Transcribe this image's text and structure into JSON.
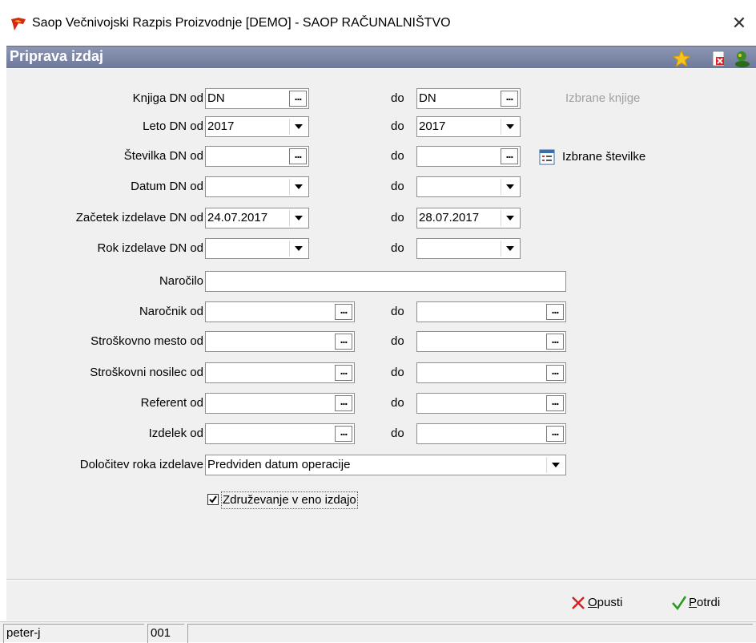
{
  "window": {
    "title": "Saop  Večnivojski Razpis Proizvodnje  [DEMO] - SAOP RAČUNALNIŠTVO",
    "close_glyph": "✕"
  },
  "header": {
    "title": "Priprava izdaj",
    "icons": [
      "star-icon",
      "close-doc-icon",
      "user-icon"
    ]
  },
  "form": {
    "do_label": "do",
    "rows": [
      {
        "label": "Knjiga DN od",
        "from": "DN",
        "to": "DN",
        "control": "ellipsis"
      },
      {
        "label": "Leto DN od",
        "from": "2017",
        "to": "2017",
        "control": "dropdown"
      },
      {
        "label": "Številka DN od",
        "from": "",
        "to": "",
        "control": "ellipsis"
      },
      {
        "label": "Datum DN od",
        "from": "",
        "to": "",
        "control": "dropdown"
      },
      {
        "label": "Začetek izdelave DN od",
        "from": "24.07.2017",
        "to": "28.07.2017",
        "control": "dropdown"
      },
      {
        "label": "Rok izdelave DN od",
        "from": "",
        "to": "",
        "control": "dropdown"
      }
    ],
    "side": {
      "izbrane_knjige": "Izbrane knjige",
      "izbrane_stevilke": "Izbrane številke"
    },
    "narocilo": {
      "label": "Naročilo",
      "value": ""
    },
    "wide_rows": [
      {
        "label": "Naročnik od",
        "from": "",
        "to": ""
      },
      {
        "label": "Stroškovno mesto od",
        "from": "",
        "to": ""
      },
      {
        "label": "Stroškovni nosilec od",
        "from": "",
        "to": ""
      },
      {
        "label": "Referent od",
        "from": "",
        "to": ""
      },
      {
        "label": "Izdelek od",
        "from": "",
        "to": ""
      }
    ],
    "dolocitev": {
      "label": "Določitev roka izdelave",
      "value": "Predviden datum operacije"
    },
    "zdruzevanje": {
      "label": "Združevanje v eno izdajo",
      "checked": true
    }
  },
  "footer": {
    "opusti_rest": "pusti",
    "opusti_key": "O",
    "potrdi_rest": "otrdi",
    "potrdi_key": "P"
  },
  "status": {
    "user": "peter-j",
    "code": "001"
  },
  "colors": {
    "header_bg": "#7c86a6",
    "form_bg": "#f0f0f0",
    "opusti_x": "#d42020",
    "potrdi_check": "#2a9a20"
  }
}
